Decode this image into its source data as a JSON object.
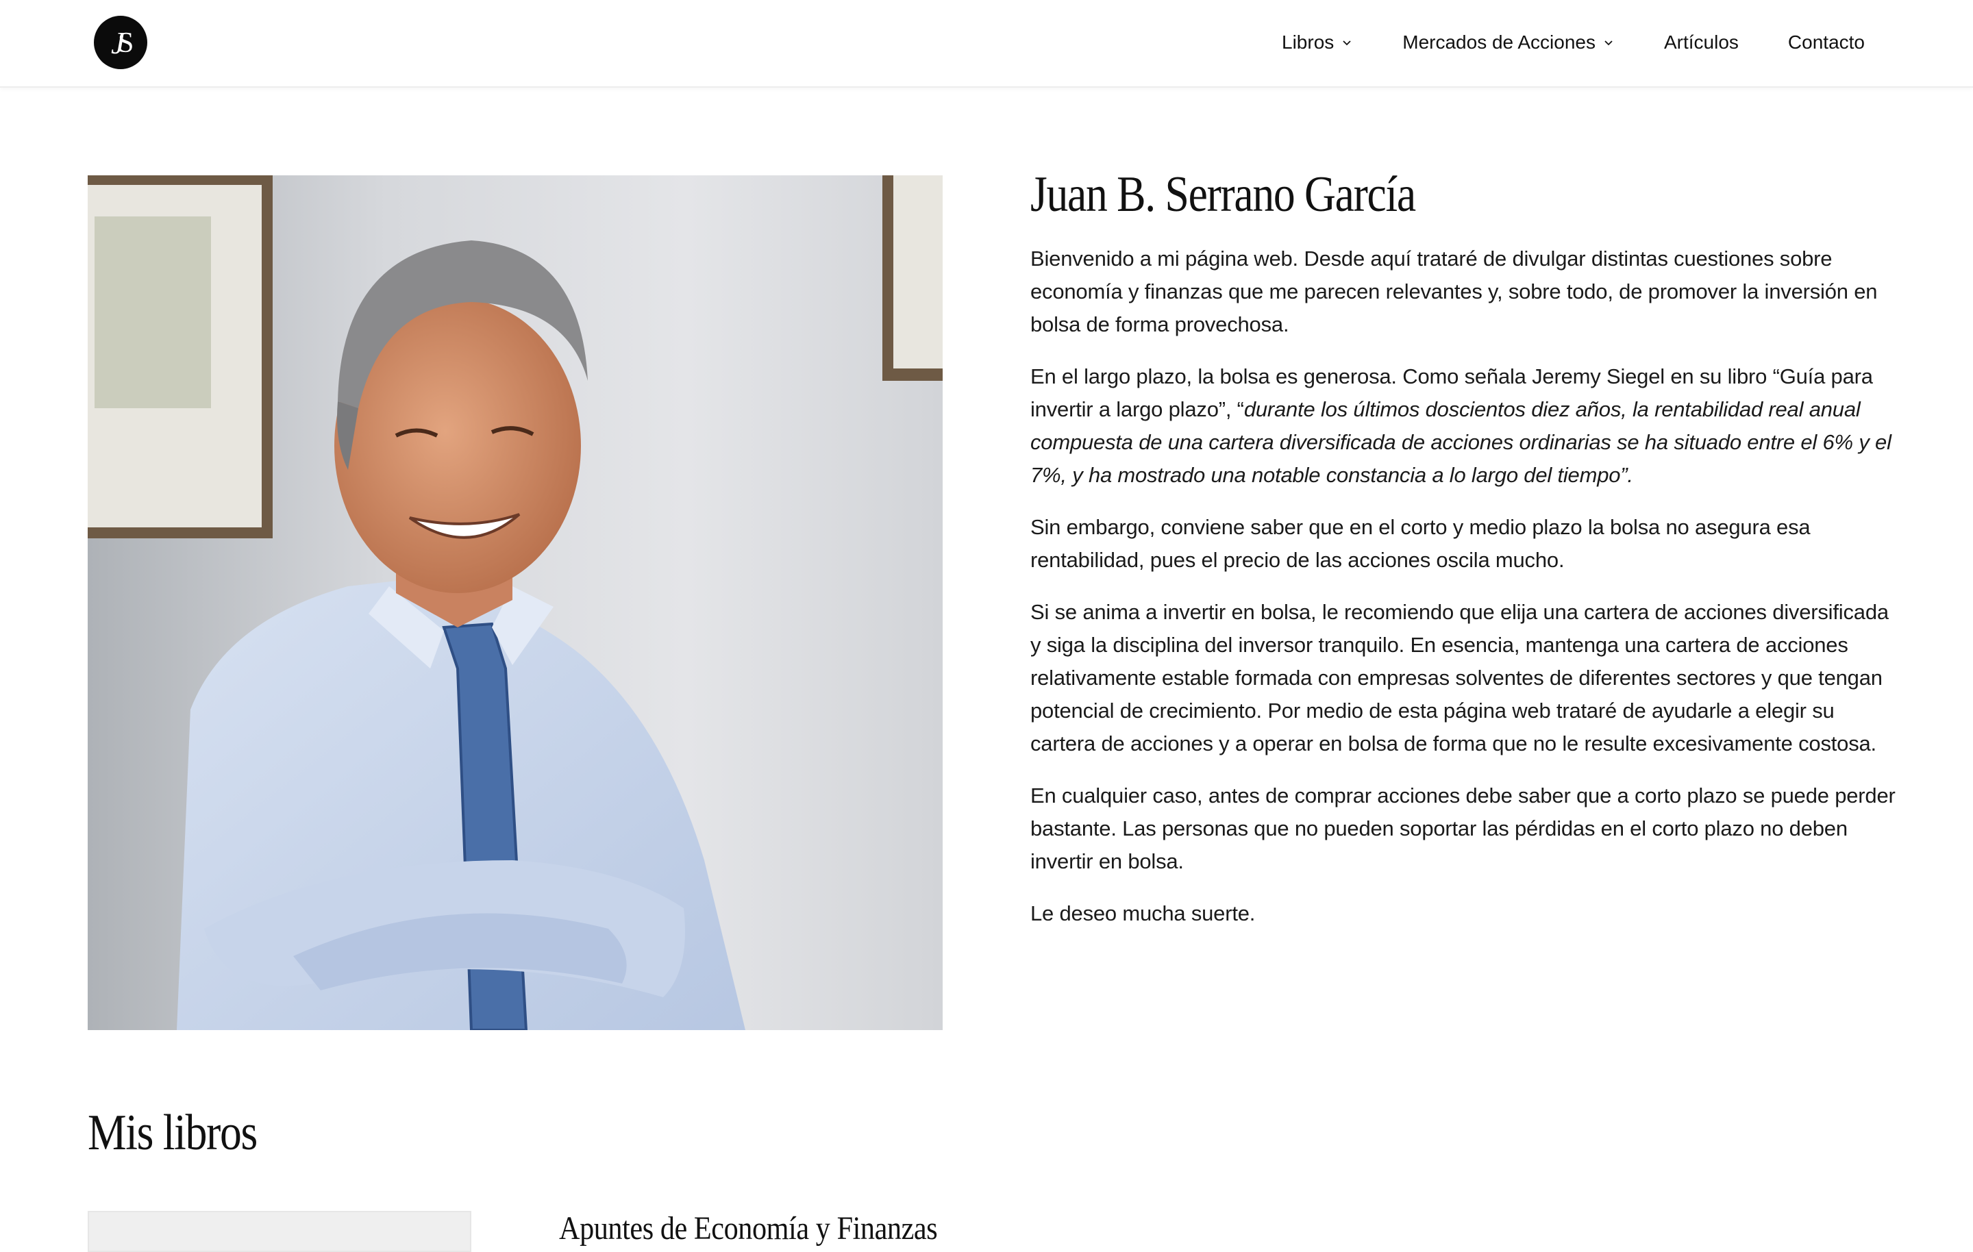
{
  "header": {
    "logo_alt": "JS",
    "nav": [
      {
        "label": "Libros",
        "has_dropdown": true
      },
      {
        "label": "Mercados de Acciones",
        "has_dropdown": true
      },
      {
        "label": "Artículos",
        "has_dropdown": false
      },
      {
        "label": "Contacto",
        "has_dropdown": false
      }
    ]
  },
  "hero": {
    "title": "Juan B. Serrano García",
    "p1": "Bienvenido a mi página web. Desde aquí trataré de divulgar distintas cuestiones sobre economía y finanzas que me parecen relevantes y, sobre todo, de promover la inversión en bolsa de forma provechosa.",
    "p2_intro": "En el largo plazo, la bolsa es generosa. Como señala Jeremy Siegel en su libro “Guía para invertir a largo plazo”, “",
    "p2_quote": "durante los últimos doscientos diez años, la rentabilidad real anual compuesta de una cartera diversificada de acciones ordinarias se ha situado entre el 6% y el 7%, y ha mostrado una notable constancia a lo largo del tiempo”.",
    "p3": "Sin embargo, conviene saber que en el corto y medio plazo la bolsa no asegura esa rentabilidad, pues el precio de las acciones oscila mucho.",
    "p4": "Si se anima a invertir en bolsa, le recomiendo que elija una cartera de acciones diversificada y siga la disciplina del inversor tranquilo. En esencia, mantenga una cartera de acciones relativamente estable formada con empresas solventes de diferentes sectores y que tengan potencial de crecimiento. Por medio de esta página web trataré de ayudarle a elegir su cartera de acciones y a operar en bolsa de forma que no le resulte excesivamente costosa.",
    "p5": "En cualquier caso, antes de comprar acciones debe saber que a corto plazo se puede perder bastante. Las personas que no pueden soportar las pérdidas en el corto plazo no deben invertir en bolsa.",
    "p6": "Le deseo mucha suerte."
  },
  "books": {
    "title": "Mis libros",
    "first_book_title": "Apuntes de Economía y Finanzas"
  },
  "colors": {
    "text": "#111111",
    "background": "#ffffff",
    "shirt": "#c9d6ec",
    "tie": "#4a6fa8"
  }
}
